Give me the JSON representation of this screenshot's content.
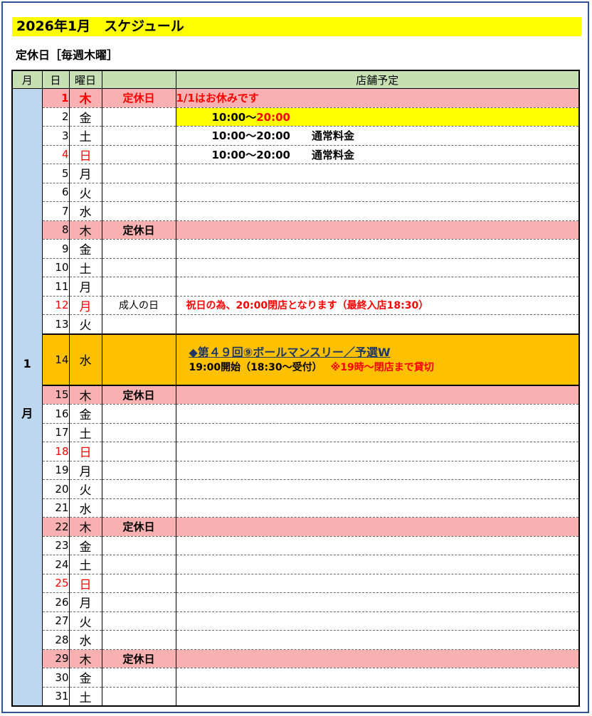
{
  "title": "2026年1月　スケジュール",
  "holiday_note": "定休日［毎週木曜］",
  "headers": {
    "month": "月",
    "day": "日",
    "dow": "曜日",
    "schedule": "店舗予定"
  },
  "month_label": {
    "top": "1",
    "bottom": "月"
  },
  "colors": {
    "title_bg": "#ffff00",
    "header_bg": "#c6e0b4",
    "month_bg": "#bdd7ee",
    "closed_bg": "#f8b0b0",
    "event_bg": "#ffc000",
    "red": "#ff0000",
    "border": "#2f5597"
  },
  "rows": [
    {
      "day": "1",
      "dow": "木",
      "note": "定休日",
      "schedule": "1/1はお休みです"
    },
    {
      "day": "2",
      "dow": "金",
      "note": "",
      "time_start": "10:00～",
      "time_end": "20:00"
    },
    {
      "day": "3",
      "dow": "土",
      "note": "",
      "time": "10:00～20:00",
      "price": "通常料金"
    },
    {
      "day": "4",
      "dow": "日",
      "note": "",
      "time": "10:00～20:00",
      "price": "通常料金"
    },
    {
      "day": "5",
      "dow": "月",
      "note": ""
    },
    {
      "day": "6",
      "dow": "火",
      "note": ""
    },
    {
      "day": "7",
      "dow": "水",
      "note": ""
    },
    {
      "day": "8",
      "dow": "木",
      "note": "定休日"
    },
    {
      "day": "9",
      "dow": "金",
      "note": ""
    },
    {
      "day": "10",
      "dow": "土",
      "note": ""
    },
    {
      "day": "11",
      "dow": "月",
      "note": ""
    },
    {
      "day": "12",
      "dow": "月",
      "note": "成人の日",
      "schedule": "祝日の為、20:00閉店となります（最終入店18:30）"
    },
    {
      "day": "13",
      "dow": "火",
      "note": ""
    },
    {
      "day": "14",
      "dow": "水",
      "note": "",
      "event_title": "◆第４９回⑨ボールマンスリー／予選W",
      "event_time": "19:00開始（18:30～受付）",
      "event_note": "※19時～閉店まで貸切"
    },
    {
      "day": "15",
      "dow": "木",
      "note": "定休日"
    },
    {
      "day": "16",
      "dow": "金",
      "note": ""
    },
    {
      "day": "17",
      "dow": "土",
      "note": ""
    },
    {
      "day": "18",
      "dow": "日",
      "note": ""
    },
    {
      "day": "19",
      "dow": "月",
      "note": ""
    },
    {
      "day": "20",
      "dow": "火",
      "note": ""
    },
    {
      "day": "21",
      "dow": "水",
      "note": ""
    },
    {
      "day": "22",
      "dow": "木",
      "note": "定休日"
    },
    {
      "day": "23",
      "dow": "金",
      "note": ""
    },
    {
      "day": "24",
      "dow": "土",
      "note": ""
    },
    {
      "day": "25",
      "dow": "日",
      "note": ""
    },
    {
      "day": "26",
      "dow": "月",
      "note": ""
    },
    {
      "day": "27",
      "dow": "火",
      "note": ""
    },
    {
      "day": "28",
      "dow": "水",
      "note": ""
    },
    {
      "day": "29",
      "dow": "木",
      "note": "定休日"
    },
    {
      "day": "30",
      "dow": "金",
      "note": ""
    },
    {
      "day": "31",
      "dow": "土",
      "note": ""
    }
  ]
}
